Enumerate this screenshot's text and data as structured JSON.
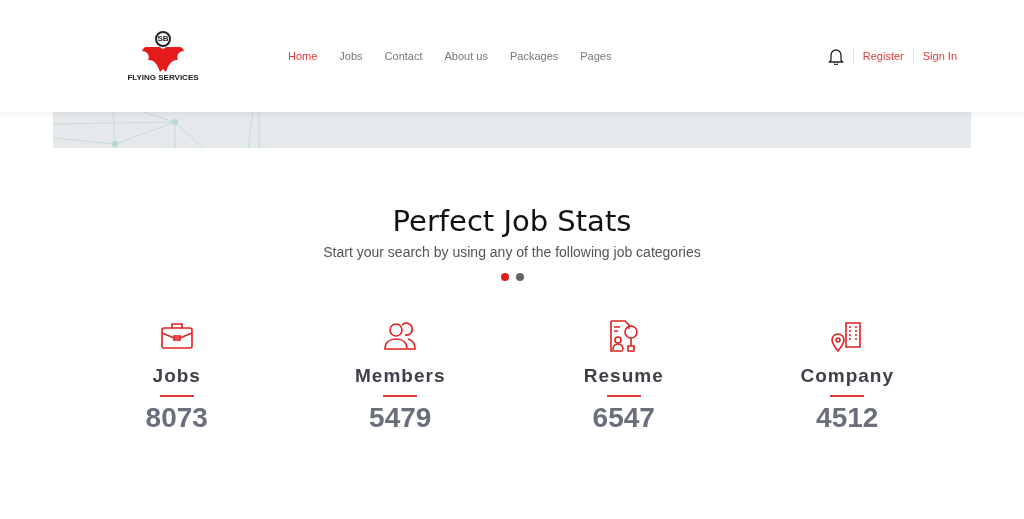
{
  "logo": {
    "initials": "SB",
    "tagline": "FLYING SERVICES"
  },
  "nav": [
    {
      "label": "Home",
      "selected": true
    },
    {
      "label": "Jobs",
      "selected": false
    },
    {
      "label": "Contact",
      "selected": false
    },
    {
      "label": "About us",
      "selected": false
    },
    {
      "label": "Packages",
      "selected": false
    },
    {
      "label": "Pages",
      "selected": false
    }
  ],
  "auth_links": [
    "Register",
    "Sign In"
  ],
  "section": {
    "title": "Perfect Job Stats",
    "subtitle": "Start your search by using any of the following job categories"
  },
  "slider_dots": [
    {
      "selected": true
    },
    {
      "selected": false
    }
  ],
  "stats": [
    {
      "kind": "briefcase",
      "label": "Jobs",
      "value": "8073"
    },
    {
      "kind": "members",
      "label": "Members",
      "value": "5479"
    },
    {
      "kind": "resume",
      "label": "Resume",
      "value": "6547"
    },
    {
      "kind": "company",
      "label": "Company",
      "value": "4512"
    }
  ]
}
